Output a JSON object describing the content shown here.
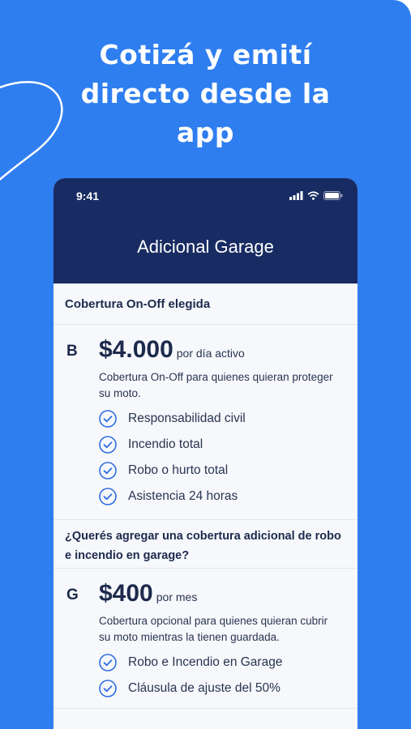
{
  "headline": "Cotizá y emití\ndirecto desde la\napp",
  "phone": {
    "status_time": "9:41",
    "screen_title": "Adicional Garage",
    "section_chosen": "Cobertura On-Off elegida",
    "plan_b": {
      "letter": "B",
      "price": "$4.000",
      "period": "por día activo",
      "description": "Cobertura On-Off para quienes quieran proteger su moto.",
      "features": [
        "Responsabilidad civil",
        "Incendio total",
        "Robo o hurto total",
        "Asistencia 24 horas"
      ]
    },
    "question": "¿Querés agregar una cobertura adicional de robo e incendio en garage?",
    "plan_g": {
      "letter": "G",
      "price": "$400",
      "period": "por mes",
      "description": "Cobertura opcional para quienes quieran cubrir su moto mientras la tienen guardada.",
      "features": [
        "Robo e Incendio en Garage",
        "Cláusula de ajuste del 50%"
      ]
    }
  },
  "colors": {
    "background": "#2f7ef0",
    "header": "#182c63",
    "check": "#2f6ee0"
  },
  "icons": [
    "signal-icon",
    "wifi-icon",
    "battery-icon",
    "check-circle-icon"
  ]
}
